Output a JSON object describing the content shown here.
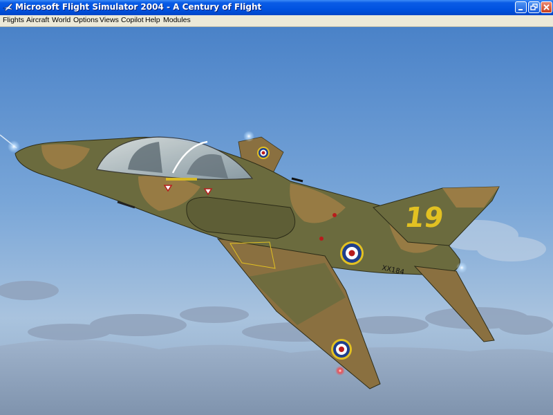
{
  "window": {
    "title": "Microsoft Flight Simulator 2004 - A Century of Flight",
    "controls": [
      "minimize-icon",
      "restore-icon",
      "close-icon"
    ]
  },
  "menu": {
    "items": [
      "Flights",
      "Aircraft",
      "World",
      "Options",
      "Views",
      "Copilot",
      "Help",
      "Modules"
    ]
  },
  "scene": {
    "aircraft_tail_number": "19",
    "aircraft_serial": "XX184",
    "colors": {
      "sky_top": "#4a82c8",
      "sky_bottom": "#a9c3de",
      "camo_green": "#6b6b3e",
      "camo_tan": "#9a7c45",
      "roundel_blue": "#1f3f8c",
      "roundel_red": "#b81c1c",
      "tail_yellow": "#e2c122"
    }
  }
}
